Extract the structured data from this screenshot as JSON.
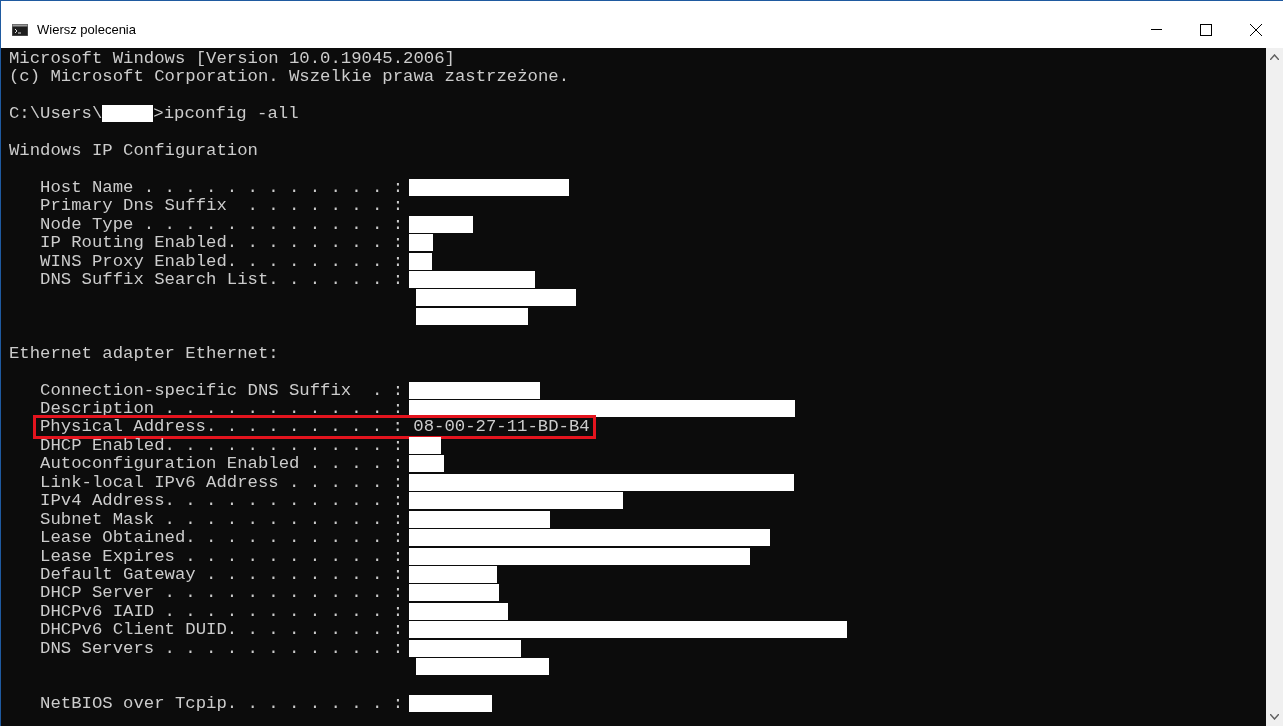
{
  "window": {
    "title": "Wiersz polecenia"
  },
  "lines": [
    {
      "kind": "text",
      "text": "Microsoft Windows [Version 10.0.19045.2006]"
    },
    {
      "kind": "text",
      "text": "(c) Microsoft Corporation. Wszelkie prawa zastrzeżone."
    },
    {
      "kind": "blank"
    },
    {
      "kind": "prompt",
      "path": "C:\\Users\\",
      "command": ">ipconfig -all"
    },
    {
      "kind": "blank"
    },
    {
      "kind": "text",
      "text": "Windows IP Configuration"
    },
    {
      "kind": "blank"
    },
    {
      "kind": "field",
      "label": "Host Name . . . . . . . . . . . . :",
      "redacted": true,
      "highlighted": false
    },
    {
      "kind": "field",
      "label": "Primary Dns Suffix  . . . . . . . :",
      "redacted": false,
      "highlighted": false
    },
    {
      "kind": "field",
      "label": "Node Type . . . . . . . . . . . . :",
      "redacted": true,
      "highlighted": false
    },
    {
      "kind": "field",
      "label": "IP Routing Enabled. . . . . . . . :",
      "redacted": true,
      "highlighted": false
    },
    {
      "kind": "field",
      "label": "WINS Proxy Enabled. . . . . . . . :",
      "redacted": true,
      "highlighted": false
    },
    {
      "kind": "field",
      "label": "DNS Suffix Search List. . . . . . :",
      "redacted": true,
      "highlighted": false
    },
    {
      "kind": "redacted"
    },
    {
      "kind": "redacted"
    },
    {
      "kind": "blank"
    },
    {
      "kind": "text",
      "text": "Ethernet adapter Ethernet:"
    },
    {
      "kind": "blank"
    },
    {
      "kind": "field",
      "label": "Connection-specific DNS Suffix  . :",
      "redacted": true,
      "highlighted": false
    },
    {
      "kind": "field",
      "label": "Description . . . . . . . . . . . :",
      "redacted": true,
      "highlighted": false
    },
    {
      "kind": "field",
      "label": "Physical Address. . . . . . . . . :",
      "value": "08-00-27-11-BD-B4",
      "redacted": false,
      "highlighted": true
    },
    {
      "kind": "field",
      "label": "DHCP Enabled. . . . . . . . . . . :",
      "redacted": true,
      "highlighted": false
    },
    {
      "kind": "field",
      "label": "Autoconfiguration Enabled . . . . :",
      "redacted": true,
      "highlighted": false
    },
    {
      "kind": "field",
      "label": "Link-local IPv6 Address . . . . . :",
      "redacted": true,
      "highlighted": false
    },
    {
      "kind": "field",
      "label": "IPv4 Address. . . . . . . . . . . :",
      "redacted": true,
      "highlighted": false
    },
    {
      "kind": "field",
      "label": "Subnet Mask . . . . . . . . . . . :",
      "redacted": true,
      "highlighted": false
    },
    {
      "kind": "field",
      "label": "Lease Obtained. . . . . . . . . . :",
      "redacted": true,
      "highlighted": false
    },
    {
      "kind": "field",
      "label": "Lease Expires . . . . . . . . . . :",
      "redacted": true,
      "highlighted": false
    },
    {
      "kind": "field",
      "label": "Default Gateway . . . . . . . . . :",
      "redacted": true,
      "highlighted": false
    },
    {
      "kind": "field",
      "label": "DHCP Server . . . . . . . . . . . :",
      "redacted": true,
      "highlighted": false
    },
    {
      "kind": "field",
      "label": "DHCPv6 IAID . . . . . . . . . . . :",
      "redacted": true,
      "highlighted": false
    },
    {
      "kind": "field",
      "label": "DHCPv6 Client DUID. . . . . . . . :",
      "redacted": true,
      "highlighted": false
    },
    {
      "kind": "field",
      "label": "DNS Servers . . . . . . . . . . . :",
      "redacted": true,
      "highlighted": false
    },
    {
      "kind": "redacted"
    },
    {
      "kind": "blank"
    },
    {
      "kind": "field",
      "label": "NetBIOS over Tcpip. . . . . . . . :",
      "redacted": true,
      "highlighted": false
    }
  ]
}
